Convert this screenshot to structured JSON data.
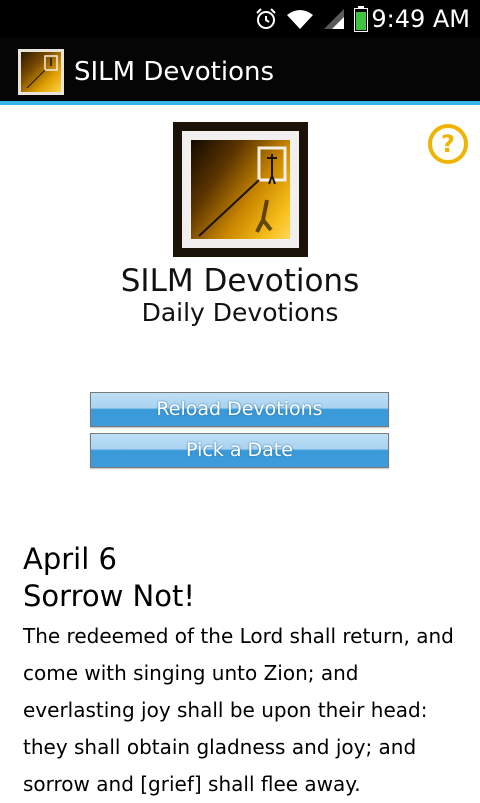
{
  "status_bar": {
    "time": "9:49 AM",
    "icons": [
      "alarm-icon",
      "wifi-icon",
      "signal-icon",
      "battery-icon"
    ]
  },
  "action_bar": {
    "title": "SILM Devotions",
    "accent_color": "#33b5e5"
  },
  "header": {
    "title": "SILM Devotions",
    "subtitle": "Daily Devotions"
  },
  "buttons": {
    "reload_label": "Reload Devotions",
    "pick_date_label": "Pick a Date"
  },
  "devotion": {
    "date": "April 6",
    "title": "Sorrow Not!",
    "body": "The redeemed of the Lord shall return, and come with singing unto Zion; and everlasting joy shall be upon their head: they shall obtain gladness and joy; and sorrow and [grief] shall flee away."
  },
  "colors": {
    "help_icon": "#f0b400",
    "button_top": "#a9d3f1",
    "button_bottom": "#3d9bdb"
  }
}
